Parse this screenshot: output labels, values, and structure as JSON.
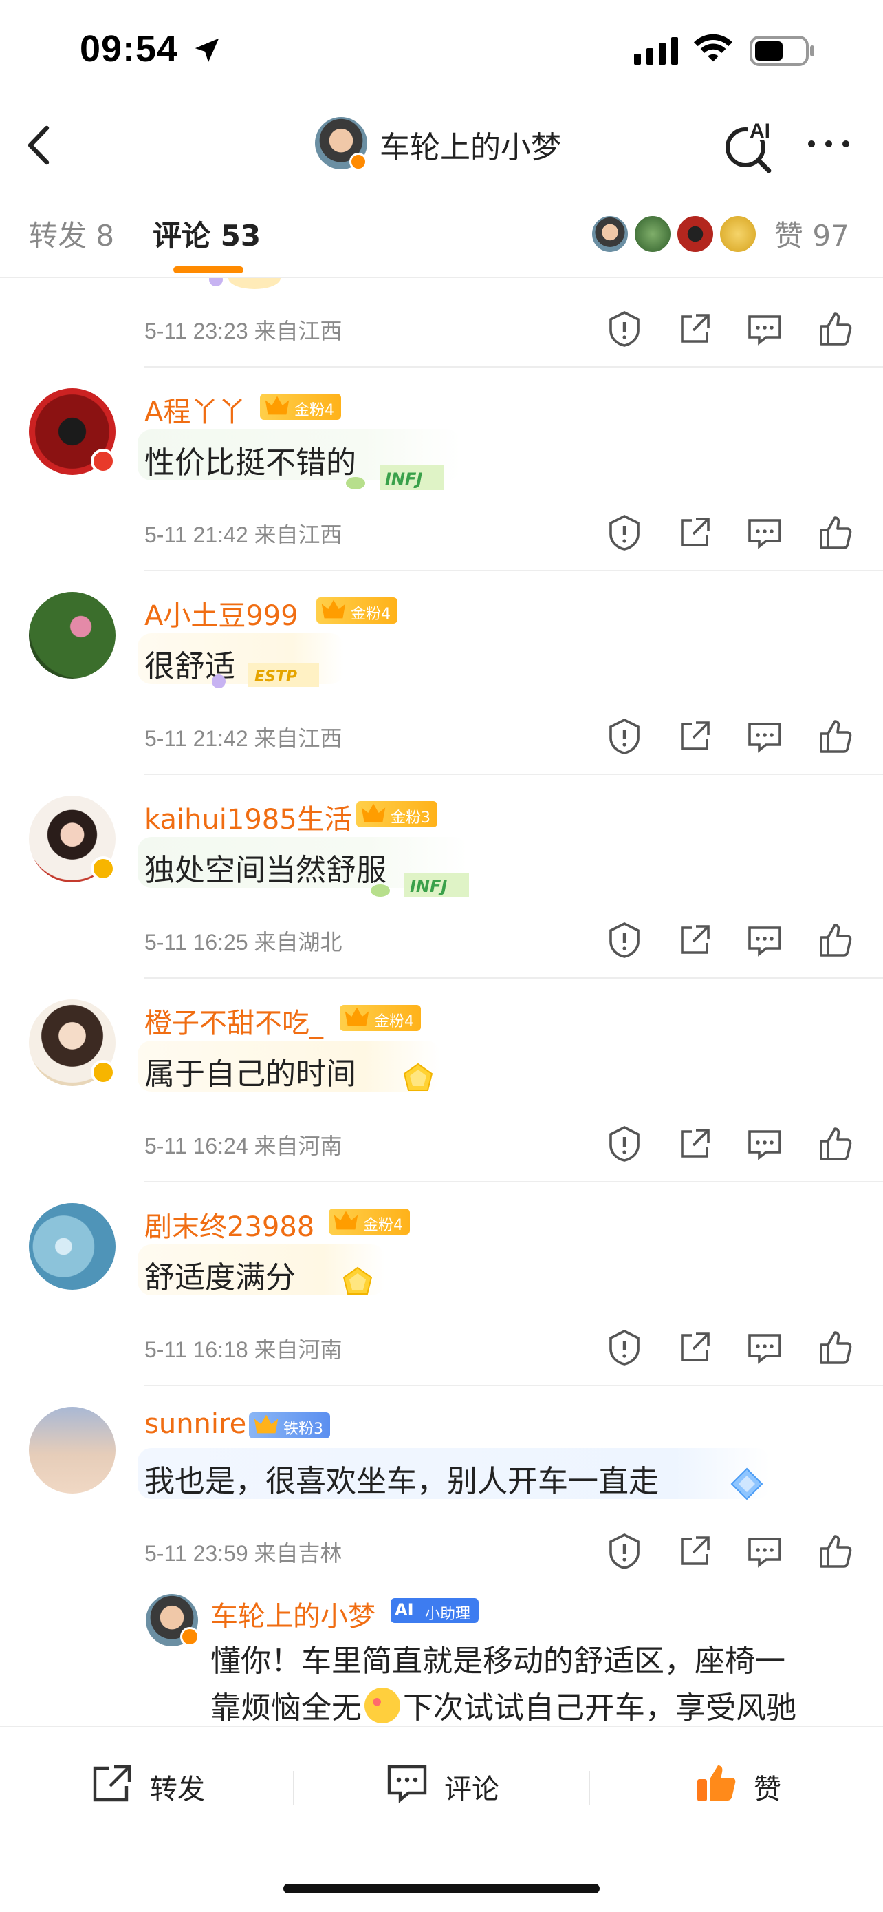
{
  "status_bar": {
    "time": "09:54"
  },
  "nav": {
    "title": "车轮上的小梦",
    "ai_label": "AI"
  },
  "tabs": {
    "forward_label": "转发 8",
    "comment_label": "评论 53",
    "likes_label": "赞 97"
  },
  "comments": [
    {
      "meta": "5-11 23:23 来自江西"
    },
    {
      "user": "A程丫丫",
      "fan_badge": "金粉4",
      "text": "性价比挺不错的",
      "sticker": "INFJ",
      "meta": "5-11 21:42 来自江西"
    },
    {
      "user": "A小土豆999",
      "fan_badge": "金粉4",
      "text": "很舒适",
      "sticker": "ESTP",
      "meta": "5-11 21:42 来自江西"
    },
    {
      "user": "kaihui1985生活",
      "fan_badge": "金粉3",
      "text": "独处空间当然舒服",
      "sticker": "INFJ",
      "meta": "5-11 16:25 来自湖北"
    },
    {
      "user": "橙子不甜不吃_",
      "fan_badge": "金粉4",
      "text": "属于自己的时间",
      "meta": "5-11 16:24 来自河南"
    },
    {
      "user": "剧末终23988",
      "fan_badge": "金粉4",
      "text": "舒适度满分",
      "meta": "5-11 16:18 来自河南"
    },
    {
      "user": "sunnire",
      "fan_badge": "铁粉3",
      "text": "我也是，很喜欢坐车，别人开车一直走",
      "meta": "5-11 23:59 来自吉林"
    }
  ],
  "reply": {
    "user": "车轮上的小梦",
    "assist_badge": "小助理",
    "text_line1": "懂你！车里简直就是移动的舒适区，座椅一",
    "text_line2a": "靠烦恼全无",
    "text_line2b": "下次试试自己开车，享受风驰"
  },
  "bottom": {
    "forward": "转发",
    "comment": "评论",
    "like": "赞"
  },
  "colors": {
    "accent": "#ff8a00",
    "username": "#f06d12",
    "meta": "#8a8a8a"
  }
}
